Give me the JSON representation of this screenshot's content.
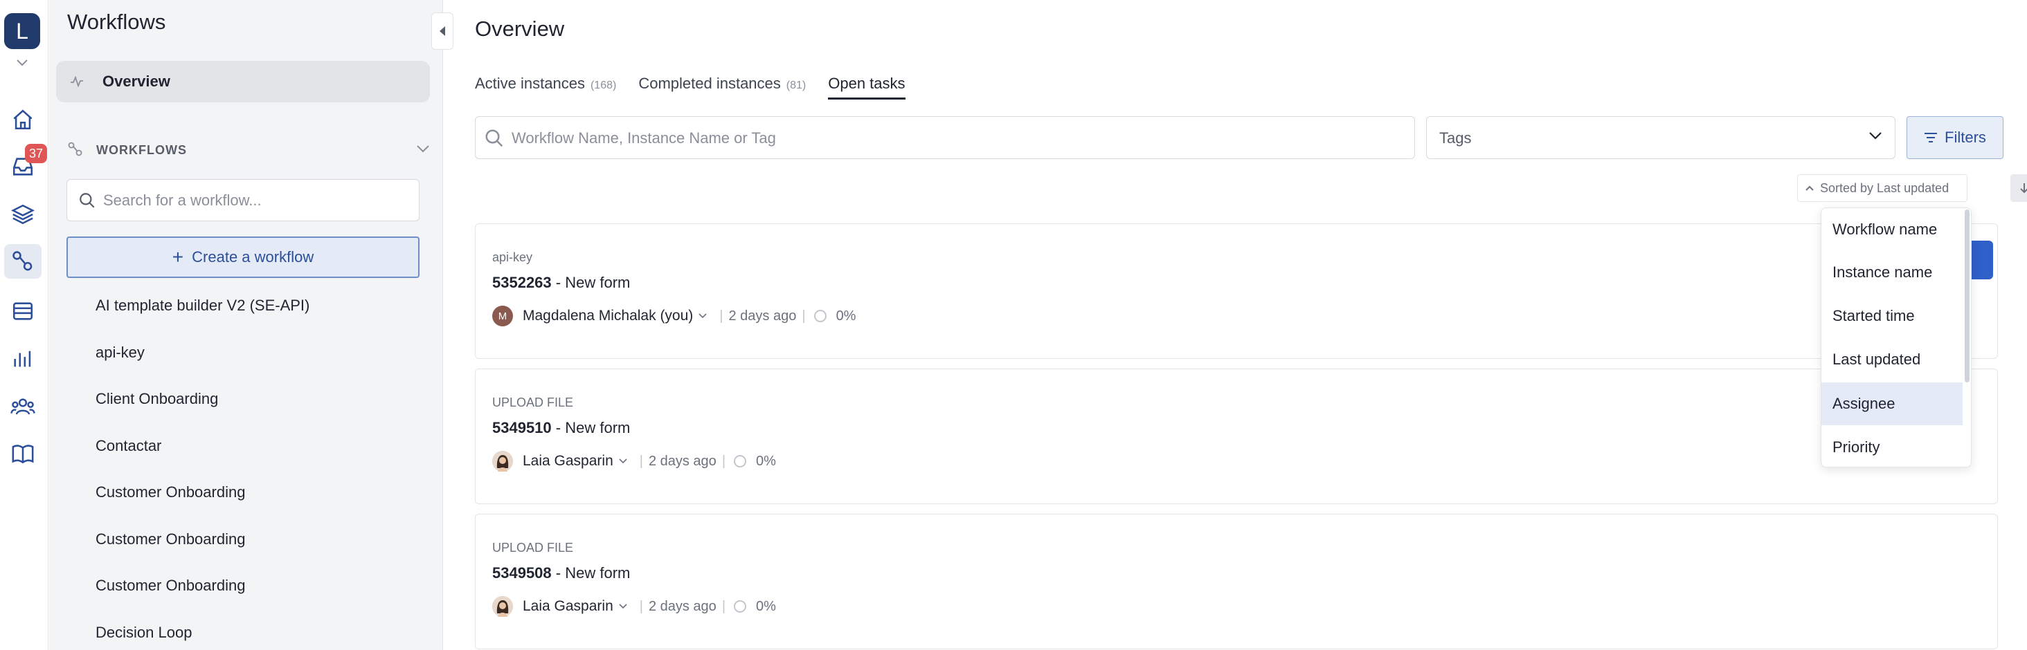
{
  "rail": {
    "logo_letter": "L",
    "inbox_badge": "37",
    "icons": [
      "home-icon",
      "inbox-icon",
      "layers-icon",
      "workflows-icon",
      "table-icon",
      "chart-icon",
      "users-icon",
      "book-icon"
    ],
    "active_icon": "workflows-icon"
  },
  "sidebar": {
    "title": "Workflows",
    "overview_label": "Overview",
    "section_label": "WORKFLOWS",
    "search_placeholder": "Search for a workflow...",
    "create_label": "Create a workflow",
    "workflows": [
      "AI template builder V2 (SE-API)",
      "api-key",
      "Client Onboarding",
      "Contactar",
      "Customer Onboarding",
      "Customer Onboarding",
      "Customer Onboarding",
      "Decision Loop"
    ]
  },
  "main": {
    "title": "Overview",
    "tabs": [
      {
        "label": "Active instances",
        "count": "(168)"
      },
      {
        "label": "Completed instances",
        "count": "(81)"
      },
      {
        "label": "Open tasks",
        "count": ""
      }
    ],
    "active_tab": 2,
    "search_placeholder": "Workflow Name, Instance Name or Tag",
    "tags_label": "Tags",
    "filters_label": "Filters",
    "sort_label": "Sorted by Last updated",
    "sort_options": [
      "Workflow name",
      "Instance name",
      "Started time",
      "Last updated",
      "Assignee",
      "Priority"
    ],
    "highlighted_option": 4,
    "cards": [
      {
        "workflow": "api-key",
        "id": "5352263",
        "name": "New form",
        "assignee": "Magdalena Michalak (you)",
        "avatar_letter": "M",
        "updated": "2 days ago",
        "progress": "0%"
      },
      {
        "workflow": "UPLOAD FILE",
        "id": "5349510",
        "name": "New form",
        "assignee": "Laia Gasparin",
        "avatar_letter": "",
        "updated": "2 days ago",
        "progress": "0%"
      },
      {
        "workflow": "UPLOAD FILE",
        "id": "5349508",
        "name": "New form",
        "assignee": "Laia Gasparin",
        "avatar_letter": "",
        "updated": "2 days ago",
        "progress": "0%"
      }
    ]
  },
  "colors": {
    "brand_dark": "#1f3a6b",
    "accent": "#2f5fc9",
    "badge": "#e05656"
  }
}
